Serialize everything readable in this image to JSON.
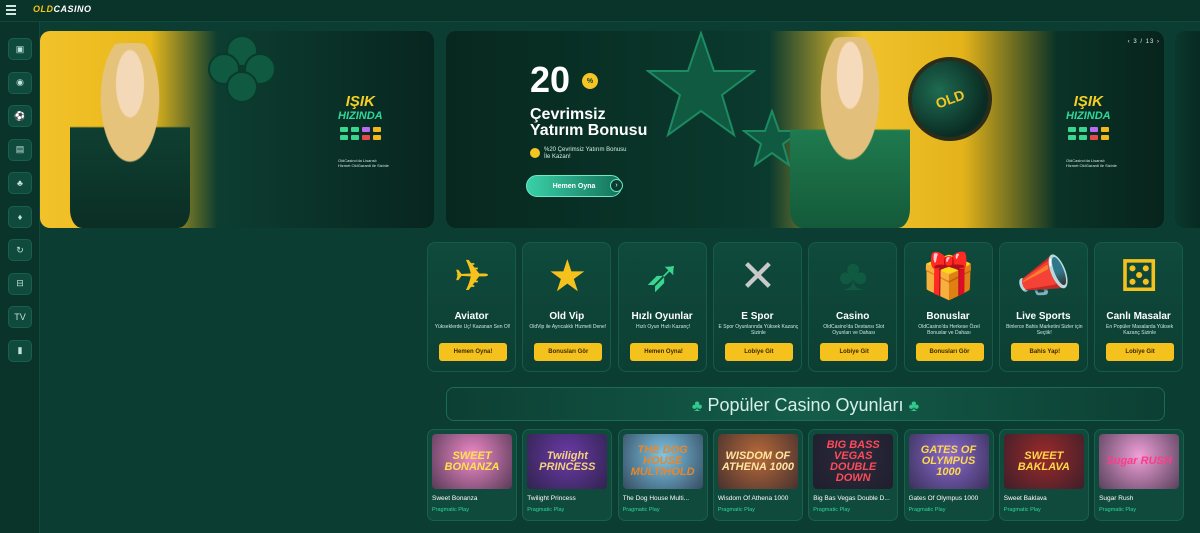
{
  "header": {
    "logo_part1": "OLD",
    "logo_part2": "CASINO"
  },
  "sidebar": {
    "items": [
      {
        "icon": "gift-icon",
        "glyph": "▣"
      },
      {
        "icon": "live-icon",
        "glyph": "◉"
      },
      {
        "icon": "football-icon",
        "glyph": "⚽"
      },
      {
        "icon": "slots-icon",
        "glyph": "▤"
      },
      {
        "icon": "poker-icon",
        "glyph": "♣"
      },
      {
        "icon": "cards-icon",
        "glyph": "♦"
      },
      {
        "icon": "refresh-icon",
        "glyph": "↻"
      },
      {
        "icon": "games-icon",
        "glyph": "⊟"
      },
      {
        "icon": "tv-icon",
        "glyph": "TV"
      },
      {
        "icon": "stats-icon",
        "glyph": "▮"
      }
    ]
  },
  "banner_left": {
    "title_line1": "IŞIK",
    "title_line2": "HIZINDA",
    "fine_print": "OldCasino’ya özel Lisanslı Havale • Garantili",
    "fine_print_top": "OldCasino'da Lisanslı",
    "fine_print_bottom": "Hizmet OldGaranti ile Sizinle"
  },
  "banner_main": {
    "amount": "20",
    "pct": "%",
    "line1": "Çevrimsiz",
    "line2": "Yatırım Bonusu",
    "note": "%20 Çevrimsiz Yatırım Bonusu İle Kazan!",
    "button": "Hemen Oyna",
    "arrow": "›",
    "coin_label": "OLD",
    "counter": "‹  3 / 13  ›",
    "title_line1": "IŞIK",
    "title_line2": "HIZINDA",
    "fine_print_top": "OldCasino'da Lisanslı",
    "fine_print_bottom": "Hizmet OldGaranti ile Sizinle"
  },
  "categories": [
    {
      "title": "Aviator",
      "desc": "Yükseklerde Uç! Kazanan Sen Ol!",
      "button": "Hemen Oyna!",
      "icon": "jet-icon",
      "glyph": "✈"
    },
    {
      "title": "Old Vip",
      "desc": "OldVip ile Ayrıcalıklı Hizmeti Dene!",
      "button": "Bonusları Gör",
      "icon": "star-icon",
      "glyph": "★"
    },
    {
      "title": "Hızlı Oyunlar",
      "desc": "Hızlı Oyun Hızlı Kazanç!",
      "button": "Hemen Oyna!",
      "icon": "rocket-icon",
      "glyph": "➶"
    },
    {
      "title": "E Spor",
      "desc": "E Spor Oyunlarında Yüksek Kazanç Sizinle",
      "button": "Lobiye Git",
      "icon": "guns-icon",
      "glyph": "✕"
    },
    {
      "title": "Casino",
      "desc": "OldCasino'da Destansı Slot Oyunları ve Dahası",
      "button": "Lobiye Git",
      "icon": "clover-icon",
      "glyph": "♣"
    },
    {
      "title": "Bonuslar",
      "desc": "OldCasino'da Herkese Özel Bonuslar ve Dahası",
      "button": "Bonusları Gör",
      "icon": "giftbox-icon",
      "glyph": "🎁"
    },
    {
      "title": "Live Sports",
      "desc": "Binlerce Bahis Marketini Sizler için Seçtik!",
      "button": "Bahis Yap!",
      "icon": "whistle-icon",
      "glyph": "📣"
    },
    {
      "title": "Canlı Masalar",
      "desc": "En Popüler Masalarda Yüksek Kazanç Sizinle",
      "button": "Lobiye Git",
      "icon": "dice-icon",
      "glyph": "⚄"
    }
  ],
  "popular": {
    "title": "Popüler Casino Oyunları"
  },
  "games": [
    {
      "name": "Sweet Bonanza",
      "provider": "Pragmatic Play",
      "thumb": "SWEET BONANZA",
      "bg": "#f08ac8",
      "fg": "#ffe24a"
    },
    {
      "name": "Twilight Princess",
      "provider": "Pragmatic Play",
      "thumb": "Twilight PRINCESS",
      "bg": "#6a3aa8",
      "fg": "#f5d37a"
    },
    {
      "name": "The Dog House Multi...",
      "provider": "Pragmatic Play",
      "thumb": "THE DOG HOUSE MULTIHOLD",
      "bg": "#7cc7e8",
      "fg": "#e8862c"
    },
    {
      "name": "Wisdom Of Athena 1000",
      "provider": "Pragmatic Play",
      "thumb": "WISDOM OF ATHENA 1000",
      "bg": "#b86a3a",
      "fg": "#ffe6a0"
    },
    {
      "name": "Big Bas Vegas Double D...",
      "provider": "Pragmatic Play",
      "thumb": "BIG BASS VEGAS DOUBLE DOWN",
      "bg": "#2a2a3a",
      "fg": "#ff4a5a"
    },
    {
      "name": "Gates Of Olympus 1000",
      "provider": "Pragmatic Play",
      "thumb": "GATES OF OLYMPUS 1000",
      "bg": "#8a6ad0",
      "fg": "#ffd84a"
    },
    {
      "name": "Sweet Baklava",
      "provider": "Pragmatic Play",
      "thumb": "SWEET BAKLAVA",
      "bg": "#9a2a2a",
      "fg": "#ffd84a"
    },
    {
      "name": "Sugar Rush",
      "provider": "Pragmatic Play",
      "thumb": "Sugar RUSH",
      "bg": "#f0a0d8",
      "fg": "#ff3a8a"
    }
  ]
}
